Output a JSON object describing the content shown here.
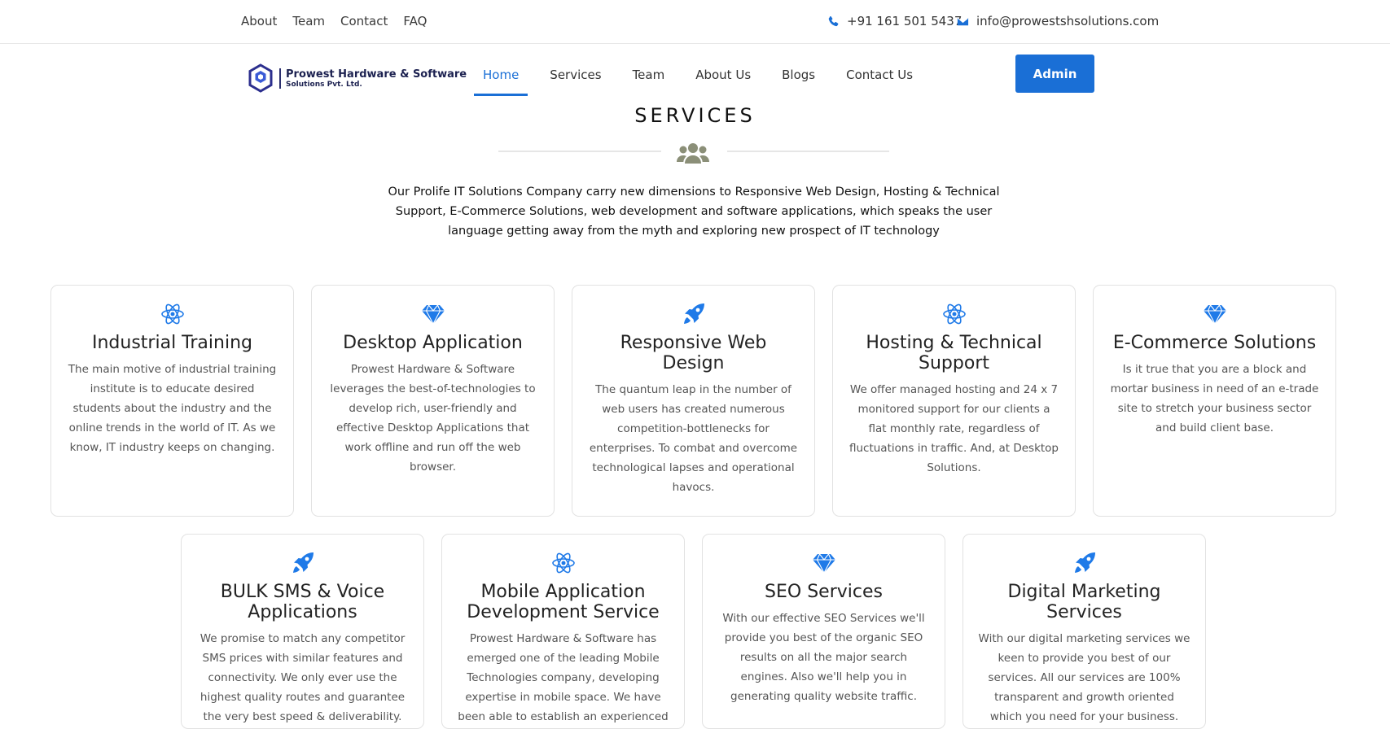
{
  "topbar": {
    "links": [
      "About",
      "Team",
      "Contact",
      "FAQ"
    ],
    "phone": "+91 161 501 5437",
    "email": "info@prowestshsolutions.com"
  },
  "logo": {
    "title": "Prowest Hardware & Software",
    "subtitle": "Solutions Pvt. Ltd."
  },
  "nav": {
    "items": [
      "Home",
      "Services",
      "Team",
      "About Us",
      "Blogs",
      "Contact Us"
    ],
    "active": "Home",
    "admin_label": "Admin"
  },
  "section": {
    "title": "SERVICES",
    "intro": "Our Prolife IT Solutions Company carry new dimensions to Responsive Web Design, Hosting & Technical Support, E-Commerce Solutions, web development and software applications, which speaks the user language getting away from the myth and exploring new prospect of IT technology"
  },
  "cards": [
    {
      "icon": "atom-icon",
      "title": "Industrial Training",
      "text": "The main motive of industrial training institute is to educate desired students about the industry and the online trends in the world of IT. As we know, IT industry keeps on changing."
    },
    {
      "icon": "diamond-icon",
      "title": "Desktop Application",
      "text": "Prowest Hardware & Software leverages the best-of-technologies to develop rich, user-friendly and effective Desktop Applications that work offline and run off the web browser."
    },
    {
      "icon": "rocket-icon",
      "title": "Responsive Web Design",
      "text": "The quantum leap in the number of web users has created numerous competition-bottlenecks for enterprises. To combat and overcome technological lapses and operational havocs."
    },
    {
      "icon": "atom-icon",
      "title": "Hosting & Technical Support",
      "text": "We offer managed hosting and 24 x 7 monitored support for our clients a flat monthly rate, regardless of fluctuations in traffic. And, at Desktop Solutions."
    },
    {
      "icon": "diamond-icon",
      "title": "E-Commerce Solutions",
      "text": "Is it true that you are a block and mortar business in need of an e-trade site to stretch your business sector and build client base."
    },
    {
      "icon": "rocket-icon",
      "title": "BULK SMS & Voice Applications",
      "text": "We promise to match any competitor SMS prices with similar features and connectivity. We only ever use the highest quality routes and guarantee the very best speed & deliverability."
    },
    {
      "icon": "atom-icon",
      "title": "Mobile Application Development Service",
      "text": "Prowest Hardware & Software has emerged one of the leading Mobile Technologies company, developing expertise in mobile space. We have been able to establish an experienced"
    },
    {
      "icon": "diamond-icon",
      "title": "SEO Services",
      "text": "With our effective SEO Services we'll provide you best of the organic SEO results on all the major search engines. Also we'll help you in generating quality website traffic."
    },
    {
      "icon": "rocket-icon",
      "title": "Digital Marketing Services",
      "text": "With our digital marketing services we keen to provide you best of our services. All our services are 100% transparent and growth oriented which you need for your business."
    }
  ],
  "colors": {
    "accent": "#1a6fd6",
    "icon_blue": "#1f7ae8",
    "divider_icon": "#8b8f78"
  }
}
